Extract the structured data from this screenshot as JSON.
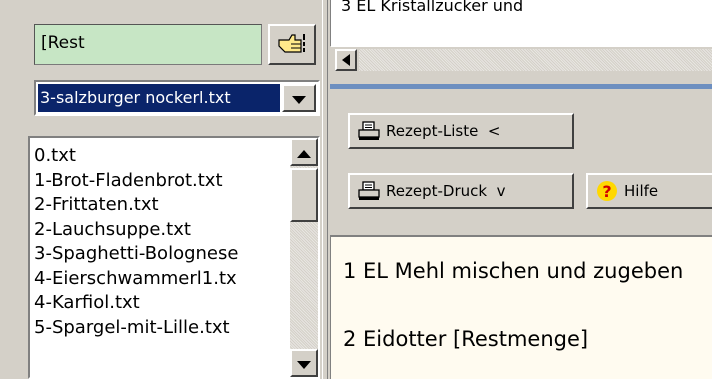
{
  "search": {
    "value": "[Rest"
  },
  "file_select": {
    "selected": "3-salzburger nockerl.txt"
  },
  "file_list": {
    "items": [
      "0.txt",
      "1-Brot-Fladenbrot.txt",
      "2-Frittaten.txt",
      "2-Lauchsuppe.txt",
      "3-Spaghetti-Bolognese",
      "4-Eierschwammerl1.tx",
      "4-Karfiol.txt",
      "5-Spargel-mit-Lille.txt"
    ]
  },
  "top_text": {
    "line": "3 EL Kristallzucker und"
  },
  "toolbar": {
    "rezept_liste": "Rezept-Liste  <",
    "rezept_druck": "Rezept-Druck  v",
    "hilfe": "Hilfe"
  },
  "main_text": {
    "line1": "1 EL Mehl mischen und zugeben",
    "line2": "2 Eidotter [Restmenge]"
  },
  "icons": {
    "pick": "hand-pointer-icon",
    "printer": "printer-icon",
    "help": "question-icon"
  },
  "colors": {
    "search_bg": "#c7e6c5",
    "selection_bg": "#0a246a",
    "accent_line": "#6d8fc0",
    "text_bg": "#fffbf0"
  }
}
